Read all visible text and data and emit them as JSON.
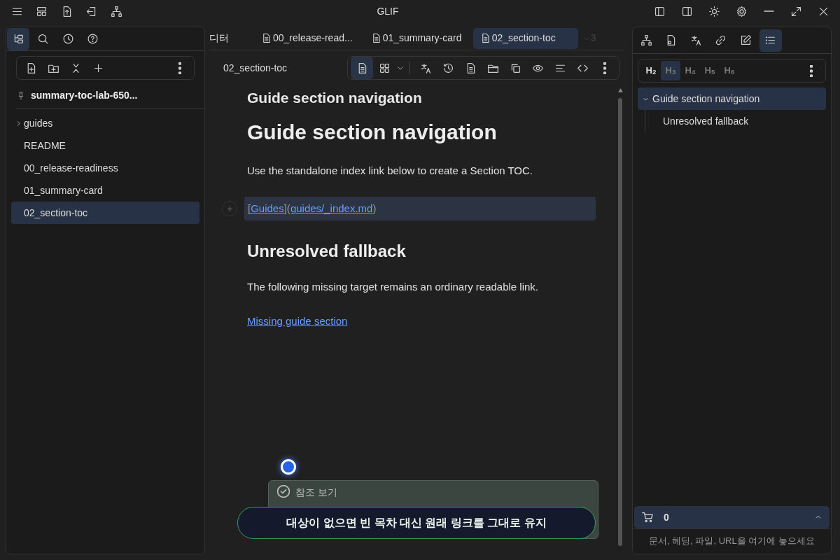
{
  "window": {
    "title": "GLIF"
  },
  "left_panel": {
    "tabs": [
      {
        "selected": true
      },
      {
        "selected": false
      },
      {
        "selected": false
      },
      {
        "selected": false
      }
    ],
    "workspace": "summary-toc-lab-650...",
    "tree": [
      {
        "label": "guides",
        "kind": "folder",
        "expanded": false,
        "selected": false
      },
      {
        "label": "README",
        "kind": "file",
        "selected": false
      },
      {
        "label": "00_release-readiness",
        "kind": "file",
        "selected": false
      },
      {
        "label": "01_summary-card",
        "kind": "file",
        "selected": false
      },
      {
        "label": "02_section-toc",
        "kind": "file",
        "selected": true
      }
    ]
  },
  "editor": {
    "tabs": [
      {
        "label": "디터",
        "kind": "plain",
        "selected": false
      },
      {
        "label": "00_release-read...",
        "kind": "doc",
        "selected": false
      },
      {
        "label": "01_summary-card",
        "kind": "doc",
        "selected": false
      },
      {
        "label": "02_section-toc",
        "kind": "doc",
        "selected": true
      }
    ],
    "more_tabs": "3",
    "file_name": "02_section-toc",
    "blocks": [
      {
        "kind": "title",
        "text": "Guide section navigation"
      },
      {
        "kind": "h1",
        "text": "Guide section navigation"
      },
      {
        "kind": "paragraph",
        "text": "Use the standalone index link below to create a Section TOC."
      },
      {
        "kind": "source",
        "selected": true,
        "parts": [
          {
            "text": "[",
            "kind": "punct"
          },
          {
            "text": "Guides",
            "kind": "link"
          },
          {
            "text": "](",
            "kind": "punct"
          },
          {
            "text": "guides/_index.md",
            "kind": "link"
          },
          {
            "text": ")",
            "kind": "punct"
          }
        ]
      },
      {
        "kind": "h2",
        "text": "Unresolved fallback"
      },
      {
        "kind": "paragraph",
        "text": "The following missing target remains an ordinary readable link."
      },
      {
        "kind": "link",
        "text": "Missing guide section"
      }
    ],
    "reference_panel": {
      "title": "참조 보기"
    },
    "toast": "대상이 없으면 빈 목차 대신 원래 링크를 그대로 유지"
  },
  "right_panel": {
    "tabs": [
      {
        "selected": false
      },
      {
        "selected": false
      },
      {
        "selected": false
      },
      {
        "selected": false
      },
      {
        "selected": false
      },
      {
        "selected": true
      }
    ],
    "levels": [
      {
        "label": "H$_{2}$",
        "active": true,
        "selected": false
      },
      {
        "label": "H$_{3}$",
        "active": false,
        "selected": true
      },
      {
        "label": "H$_{4}$",
        "active": false,
        "selected": false
      },
      {
        "label": "H$_{5}$",
        "active": false,
        "selected": false
      },
      {
        "label": "H$_{6}$",
        "active": false,
        "selected": false
      }
    ],
    "outline": [
      {
        "label": "Guide section navigation",
        "expanded": true,
        "selected": true,
        "children": [
          {
            "label": "Unresolved fallback",
            "selected": false
          }
        ]
      }
    ],
    "cart": {
      "count": "0",
      "expanded": false
    },
    "drop_hint": "문서, 헤딩, 파일, URL을 여기에 놓으세요"
  }
}
